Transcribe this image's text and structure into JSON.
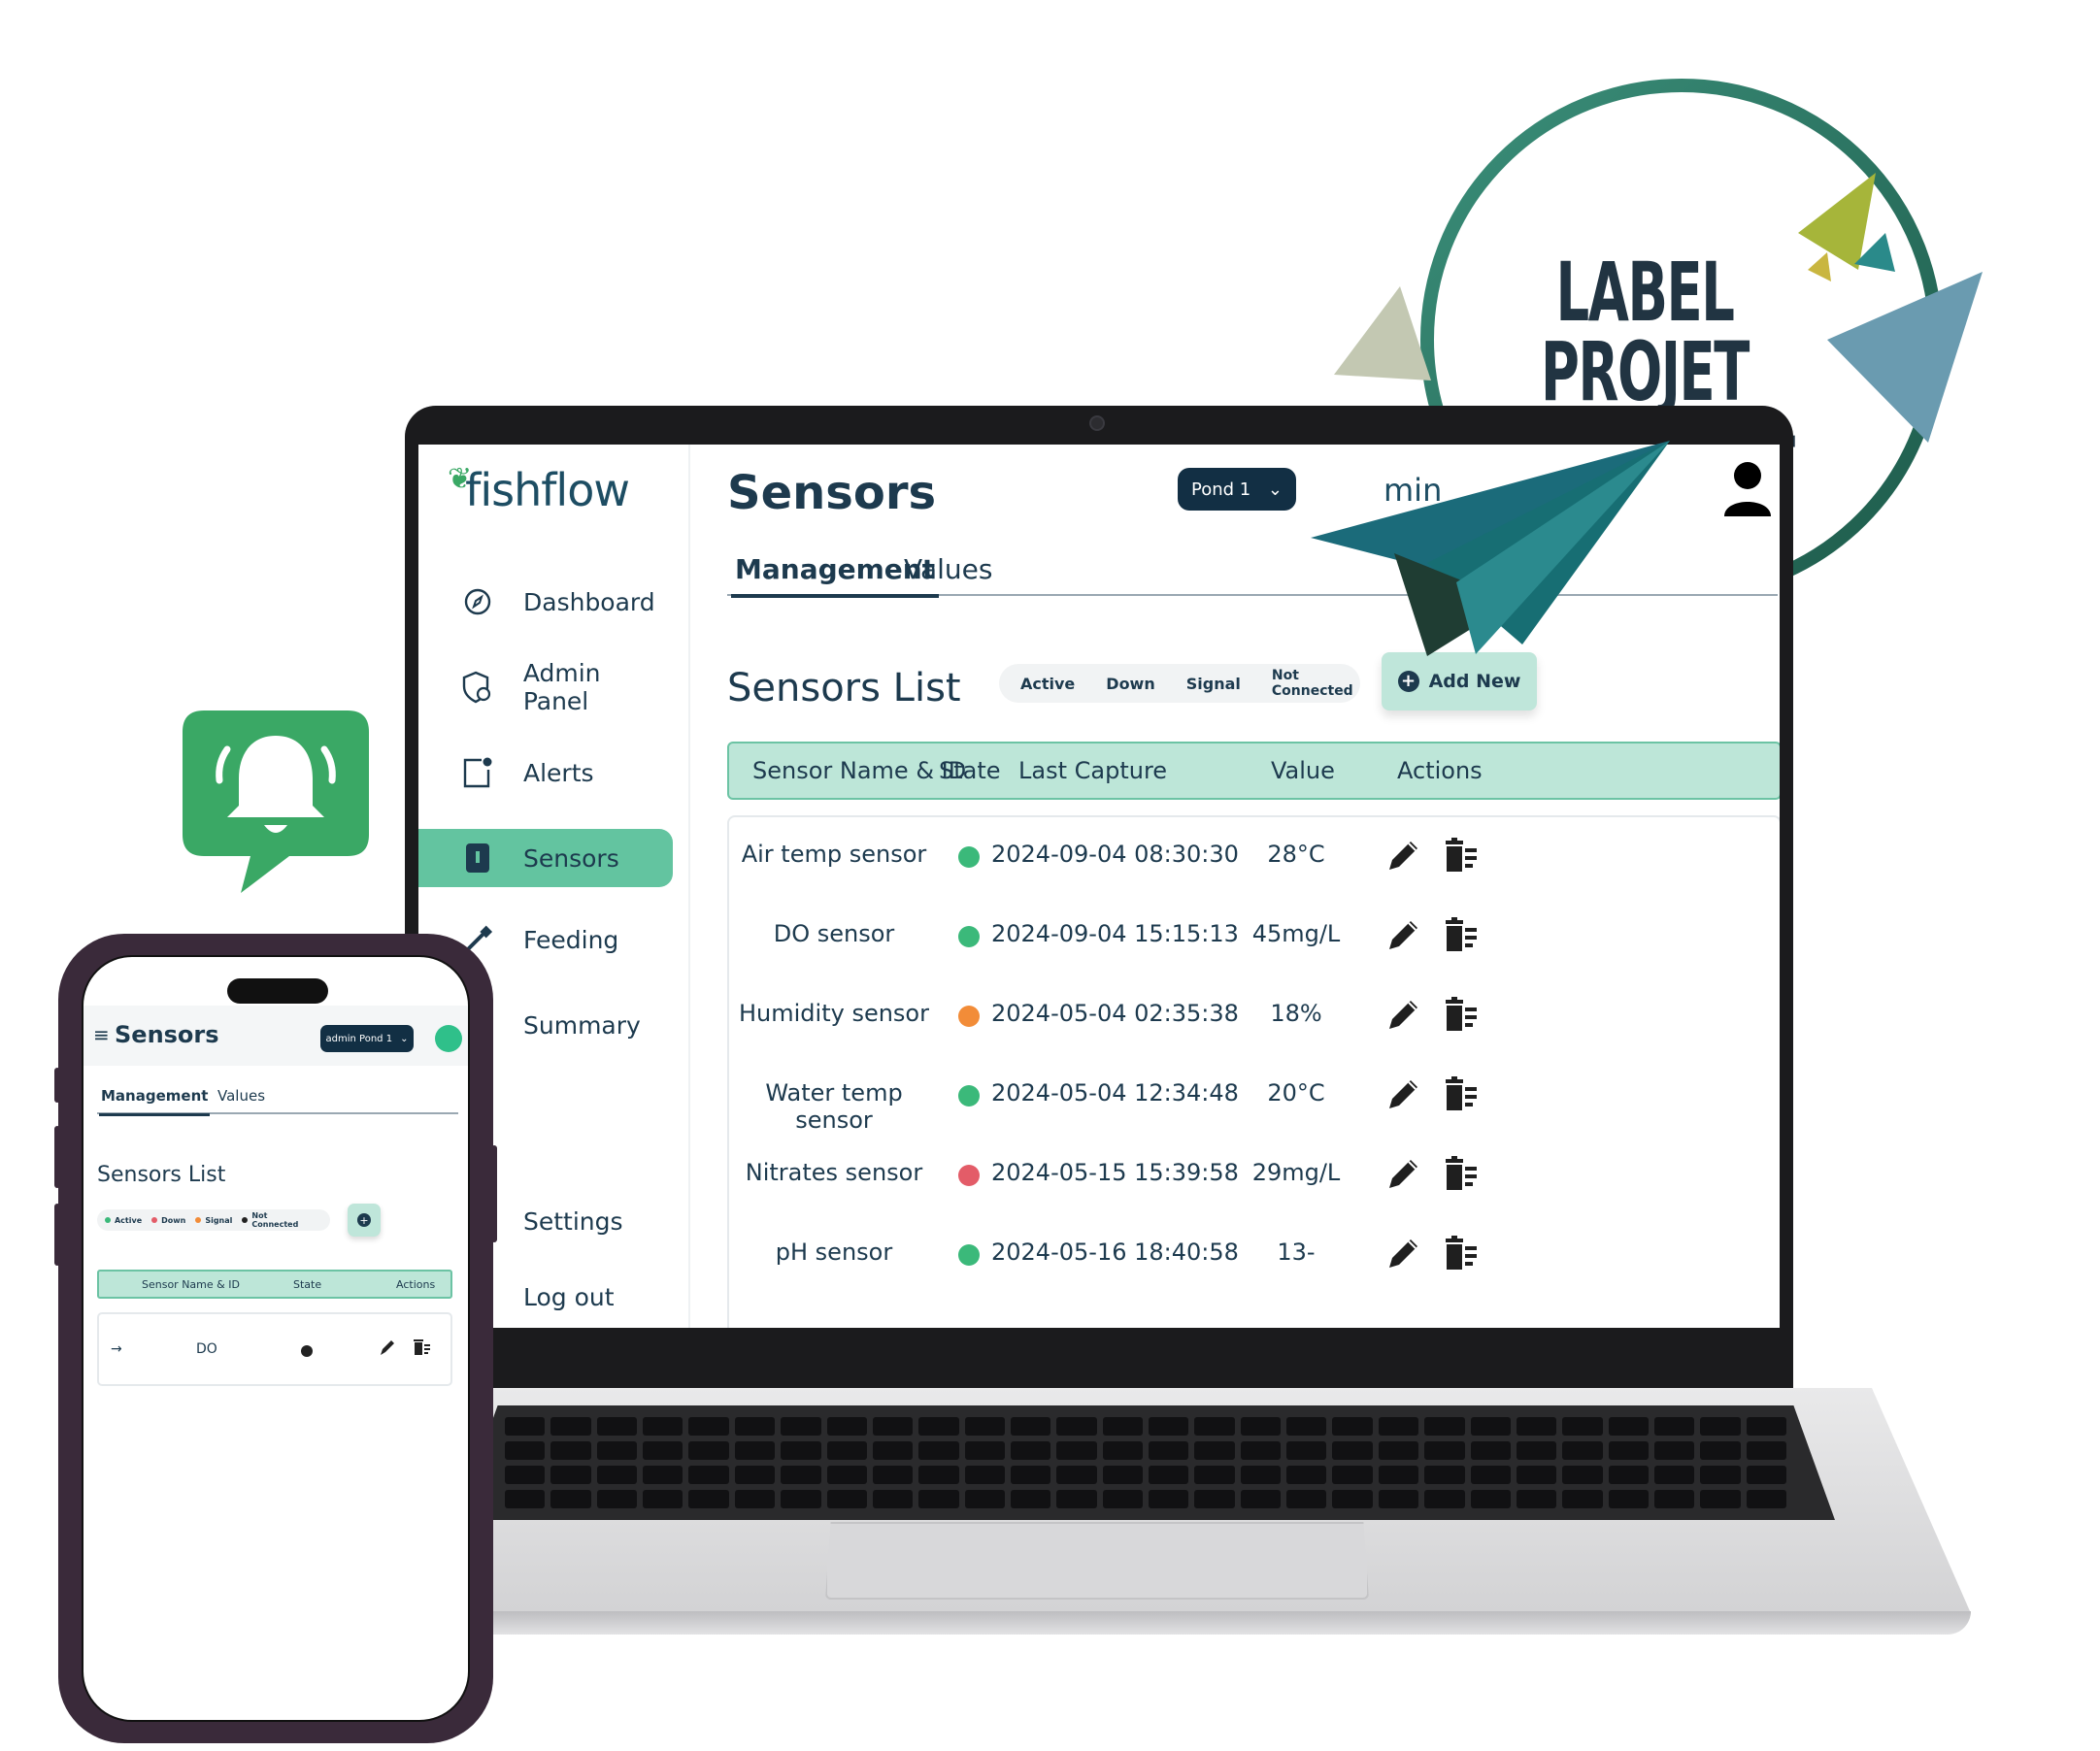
{
  "app": {
    "brand": "fishflow",
    "sidebar": {
      "items": [
        {
          "label": "Dashboard",
          "icon": "compass-icon"
        },
        {
          "label": "Admin Panel",
          "icon": "shield-user-icon"
        },
        {
          "label": "Alerts",
          "icon": "alert-window-icon"
        },
        {
          "label": "Sensors",
          "icon": "sensor-device-icon",
          "active": true
        },
        {
          "label": "Feeding",
          "icon": "feeder-icon"
        },
        {
          "label": "Summary",
          "icon": "summary-icon"
        }
      ],
      "bottom_items": [
        {
          "label": "Settings",
          "icon": "gear-icon"
        },
        {
          "label": "Log out",
          "icon": "logout-icon"
        }
      ]
    },
    "header": {
      "title": "Sensors",
      "pond_selected": "Pond 1",
      "user_label": "min"
    },
    "tabs": [
      {
        "label": "Management",
        "active": true
      },
      {
        "label": "Values",
        "active": false
      }
    ],
    "list_title": "Sensors List",
    "legend": [
      {
        "label": "Active",
        "color": "#3bb97a"
      },
      {
        "label": "Down",
        "color": "#e35c68"
      },
      {
        "label": "Signal",
        "color": "#f28c38"
      },
      {
        "label": "Not Connected",
        "color": "#222222"
      }
    ],
    "add_button": "Add New",
    "table": {
      "headers": [
        "Sensor Name & ID",
        "State",
        "Last Capture",
        "Value",
        "Actions"
      ],
      "rows": [
        {
          "name": "Air temp sensor",
          "state": "#3bb97a",
          "last_capture": "2024-09-04 08:30:30",
          "value": "28°C"
        },
        {
          "name": "DO sensor",
          "state": "#3bb97a",
          "last_capture": "2024-09-04 15:15:13",
          "value": "45mg/L"
        },
        {
          "name": "Humidity sensor",
          "state": "#f28c38",
          "last_capture": "2024-05-04 02:35:38",
          "value": "18%"
        },
        {
          "name": "Water temp sensor",
          "state": "#3bb97a",
          "last_capture": "2024-05-04 12:34:48",
          "value": "20°C"
        },
        {
          "name": "Nitrates sensor",
          "state": "#e35c68",
          "last_capture": "2024-05-15 15:39:58",
          "value": "29mg/L"
        },
        {
          "name": "pH sensor",
          "state": "#3bb97a",
          "last_capture": "2024-05-16 18:40:58",
          "value": "13-"
        }
      ]
    }
  },
  "phone": {
    "menu_icon": "≡",
    "title": "Sensors",
    "pond_label": "admin Pond 1",
    "tabs": [
      {
        "label": "Management",
        "active": true
      },
      {
        "label": "Values",
        "active": false
      }
    ],
    "list_title": "Sensors List",
    "legend": [
      {
        "label": "Active",
        "color": "#3bb97a"
      },
      {
        "label": "Down",
        "color": "#e35c68"
      },
      {
        "label": "Signal",
        "color": "#f28c38"
      },
      {
        "label": "Not Connected",
        "color": "#222222"
      }
    ],
    "table_headers": [
      "Sensor Name & ID",
      "State",
      "Actions"
    ],
    "row": {
      "arrow": "→",
      "name": "DO",
      "state": "#222222"
    }
  },
  "badge": {
    "line1": "LABEL",
    "line2": "PROJET INNOVANT"
  },
  "colors": {
    "accent": "#63c4a0",
    "navy": "#1d3a4e",
    "header_bg": "#bde6d8",
    "notification_green": "#3aa865"
  }
}
